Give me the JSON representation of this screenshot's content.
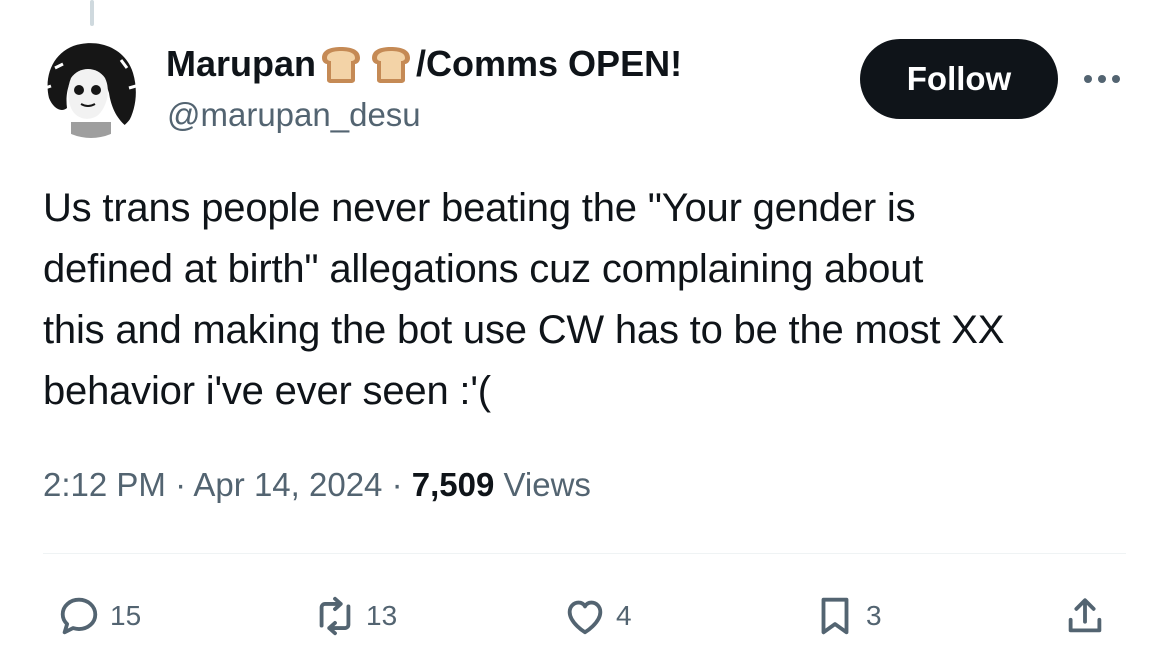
{
  "author": {
    "display_name_start": "Marupan",
    "display_name_end": "/Comms OPEN!",
    "handle": "@marupan_desu"
  },
  "follow_label": "Follow",
  "tweet": {
    "text_lines": [
      "Us trans people never beating the \"Your gender is",
      "defined at birth\" allegations cuz complaining about",
      "this and making the bot use CW has to be the most XX",
      "behavior i've ever seen :'("
    ]
  },
  "meta": {
    "time": "2:12 PM",
    "sep1": " · ",
    "date": "Apr 14, 2024",
    "sep2": " · ",
    "views_count": "7,509",
    "views_label": " Views"
  },
  "actions": {
    "replies": "15",
    "reposts": "13",
    "likes": "4",
    "bookmarks": "3"
  },
  "icons": {
    "name_emoji": "bread-emoji",
    "more": "more-dots-icon",
    "reply": "reply-icon",
    "repost": "repost-icon",
    "like": "heart-icon",
    "bookmark": "bookmark-icon",
    "share": "share-icon"
  },
  "colors": {
    "text_primary": "#0f1419",
    "text_secondary": "#536471",
    "follow_bg": "#0f1419",
    "divider": "#eff3f4"
  }
}
